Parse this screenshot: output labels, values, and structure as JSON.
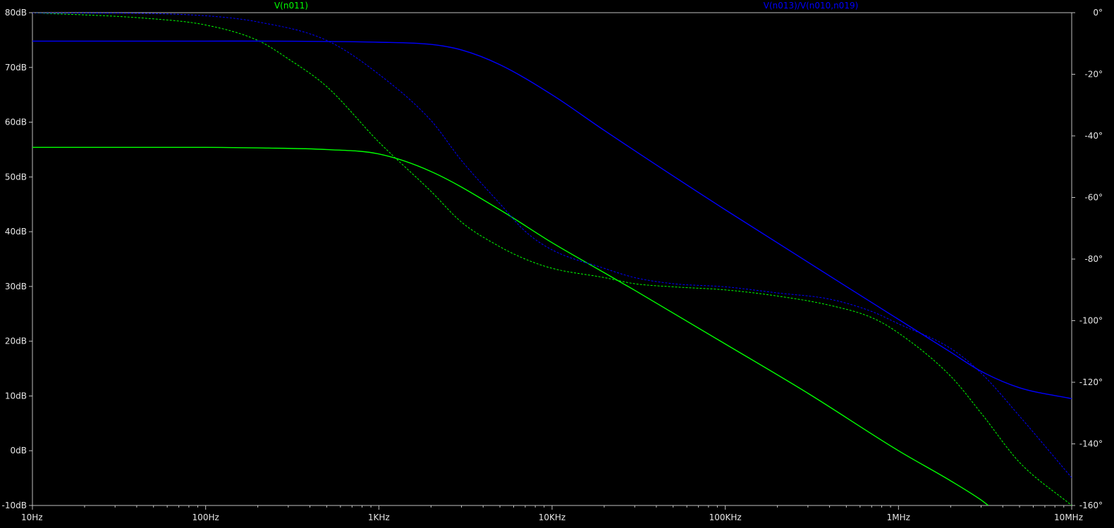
{
  "chart_data": {
    "type": "line",
    "x_scale": "log",
    "xlim": [
      10,
      10000000
    ],
    "ylim_left": [
      -10,
      80
    ],
    "ylim_right": [
      -160,
      0
    ],
    "background": "#000000",
    "axis_color": "#c0c0c0",
    "grid": false,
    "x_ticks": [
      {
        "value": 10,
        "label": "10Hz"
      },
      {
        "value": 100,
        "label": "100Hz"
      },
      {
        "value": 1000,
        "label": "1KHz"
      },
      {
        "value": 10000,
        "label": "10KHz"
      },
      {
        "value": 100000,
        "label": "100KHz"
      },
      {
        "value": 1000000,
        "label": "1MHz"
      },
      {
        "value": 10000000,
        "label": "10MHz"
      }
    ],
    "y_left_ticks": [
      {
        "value": 80,
        "label": "80dB"
      },
      {
        "value": 70,
        "label": "70dB"
      },
      {
        "value": 60,
        "label": "60dB"
      },
      {
        "value": 50,
        "label": "50dB"
      },
      {
        "value": 40,
        "label": "40dB"
      },
      {
        "value": 30,
        "label": "30dB"
      },
      {
        "value": 20,
        "label": "20dB"
      },
      {
        "value": 10,
        "label": "10dB"
      },
      {
        "value": 0,
        "label": "0dB"
      },
      {
        "value": -10,
        "label": "-10dB"
      }
    ],
    "y_right_ticks": [
      {
        "value": 0,
        "label": "0°"
      },
      {
        "value": -20,
        "label": "-20°"
      },
      {
        "value": -40,
        "label": "-40°"
      },
      {
        "value": -60,
        "label": "-60°"
      },
      {
        "value": -80,
        "label": "-80°"
      },
      {
        "value": -100,
        "label": "-100°"
      },
      {
        "value": -120,
        "label": "-120°"
      },
      {
        "value": -140,
        "label": "-140°"
      },
      {
        "value": -160,
        "label": "-160°"
      }
    ],
    "series": [
      {
        "name": "V(n011)",
        "color": "#00ff00",
        "magnitude_db": [
          [
            10,
            55.4
          ],
          [
            100,
            55.4
          ],
          [
            200,
            55.3
          ],
          [
            500,
            55.0
          ],
          [
            1000,
            54.2
          ],
          [
            2000,
            51.0
          ],
          [
            5000,
            44.0
          ],
          [
            10000,
            38.0
          ],
          [
            20000,
            32.5
          ],
          [
            30000,
            29.3
          ],
          [
            100000,
            19.5
          ],
          [
            300000,
            10.5
          ],
          [
            1000000,
            0.0
          ],
          [
            2000000,
            -5.5
          ],
          [
            3000000,
            -9.0
          ],
          [
            3300000,
            -10.0
          ]
        ],
        "phase_deg": [
          [
            10,
            0
          ],
          [
            50,
            -2
          ],
          [
            100,
            -4
          ],
          [
            200,
            -9
          ],
          [
            300,
            -15
          ],
          [
            500,
            -24
          ],
          [
            1000,
            -42
          ],
          [
            2000,
            -58
          ],
          [
            3000,
            -68
          ],
          [
            5000,
            -76
          ],
          [
            7000,
            -80
          ],
          [
            10000,
            -83
          ],
          [
            20000,
            -86
          ],
          [
            30000,
            -88
          ],
          [
            50000,
            -89
          ],
          [
            100000,
            -90
          ],
          [
            200000,
            -92
          ],
          [
            400000,
            -95
          ],
          [
            700000,
            -99
          ],
          [
            1000000,
            -104
          ],
          [
            2000000,
            -118
          ],
          [
            3000000,
            -130
          ],
          [
            5000000,
            -146
          ],
          [
            10000000,
            -160
          ]
        ]
      },
      {
        "name": "V(n013)/V(n010,n019)",
        "color": "#0000ff",
        "magnitude_db": [
          [
            10,
            74.8
          ],
          [
            100,
            74.8
          ],
          [
            1000,
            74.6
          ],
          [
            2000,
            74.2
          ],
          [
            3000,
            73.2
          ],
          [
            5000,
            70.5
          ],
          [
            10000,
            65.0
          ],
          [
            20000,
            58.5
          ],
          [
            100000,
            44.0
          ],
          [
            1000000,
            24.0
          ],
          [
            2000000,
            18.0
          ],
          [
            3000000,
            14.5
          ],
          [
            5000000,
            11.5
          ],
          [
            10000000,
            9.5
          ]
        ],
        "phase_deg": [
          [
            10,
            0
          ],
          [
            100,
            -1
          ],
          [
            200,
            -3
          ],
          [
            500,
            -9
          ],
          [
            1000,
            -20
          ],
          [
            2000,
            -35
          ],
          [
            3000,
            -48
          ],
          [
            5000,
            -62
          ],
          [
            7000,
            -71
          ],
          [
            10000,
            -77
          ],
          [
            20000,
            -83
          ],
          [
            30000,
            -86
          ],
          [
            50000,
            -88
          ],
          [
            100000,
            -89
          ],
          [
            200000,
            -91
          ],
          [
            400000,
            -93
          ],
          [
            700000,
            -97
          ],
          [
            1000000,
            -101
          ],
          [
            2000000,
            -109
          ],
          [
            3000000,
            -117
          ],
          [
            5000000,
            -131
          ],
          [
            10000000,
            -151
          ]
        ]
      }
    ]
  }
}
